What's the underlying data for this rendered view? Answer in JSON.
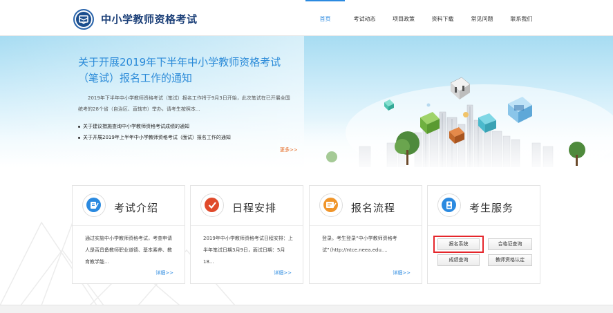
{
  "header": {
    "site_title": "中小学教师资格考试",
    "logo": "ntce-logo-icon",
    "nav": [
      {
        "label": "首页",
        "active": true
      },
      {
        "label": "考试动态",
        "active": false
      },
      {
        "label": "项目政策",
        "active": false
      },
      {
        "label": "资料下载",
        "active": false
      },
      {
        "label": "常见问题",
        "active": false
      },
      {
        "label": "联系我们",
        "active": false
      }
    ]
  },
  "banner": {
    "headline": "关于开展2019年下半年中小学教师资格考试（笔试）报名工作的通知",
    "intro": "2019年下半年中小学教师资格考试（笔试）报名工作将于9月3日开始，此次笔试在已开展全国统考的28个省（自治区、直辖市）举办，请考生按照本...",
    "news": [
      "关于建议措施查询中小学教师资格考试成绩的通知",
      "关于开展2019年上半年中小学教师资格考试（面试）报名工作的通知"
    ],
    "more": "更多>>"
  },
  "cards": [
    {
      "title": "考试介绍",
      "icon": "notepad-pen-icon",
      "body": "通过实施中小学教师资格考试，考查申请人是否具备教师职业道德、基本素养、教育教学能...",
      "more": "详细>>"
    },
    {
      "title": "日程安排",
      "icon": "checkmark-icon",
      "body": "2019年中小学教师资格考试日程安排：上半年笔试日期3月9日，面试日期：5月18...",
      "more": "详细>>"
    },
    {
      "title": "报名流程",
      "icon": "signup-form-icon",
      "body": "登录。考生登录“中小学教师资格考试”（http://ntce.neea.edu....",
      "more": "详细>>"
    },
    {
      "title": "考生服务",
      "icon": "id-card-icon",
      "buttons": [
        "报名系统",
        "合格证查询",
        "成绩查询",
        "教师资格认定"
      ]
    }
  ],
  "colors": {
    "accent": "#2b8ae0",
    "title_blue": "#1b3f78",
    "more_orange": "#e5671e",
    "highlight_red": "#e5262b"
  }
}
